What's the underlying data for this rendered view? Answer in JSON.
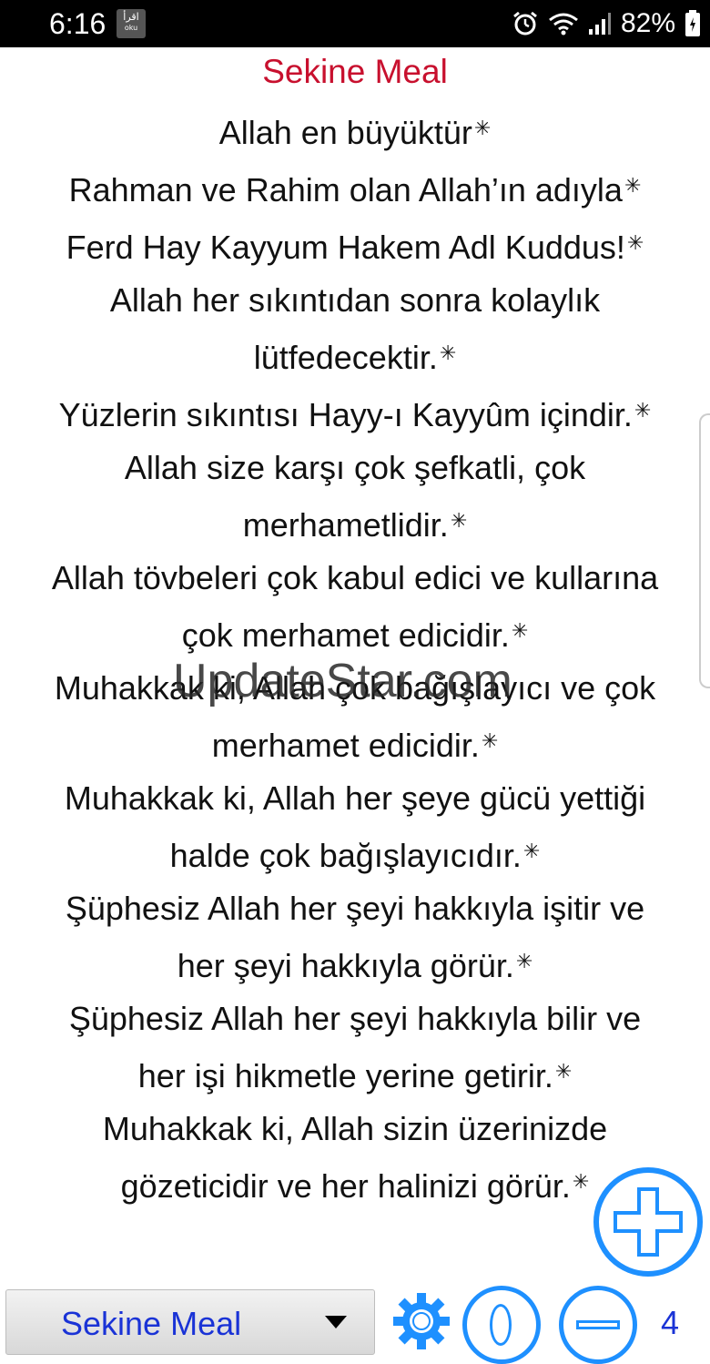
{
  "status_bar": {
    "time": "6:16",
    "app_icon_top": "اقرأ",
    "app_icon_bottom": "oku",
    "battery": "82%",
    "icons": [
      "alarm-icon",
      "wifi-icon",
      "signal-icon",
      "battery-icon"
    ]
  },
  "content": {
    "title": "Sekine Meal",
    "lines": [
      "Allah en büyüktür",
      "Rahman ve Rahim olan Allah’ın adıyla",
      "Ferd Hay Kayyum Hakem Adl Kuddus!",
      "Allah her sıkıntıdan sonra kolaylık",
      "lütfedecektir.",
      "Yüzlerin sıkıntısı Hayy-ı Kayyûm içindir.",
      "Allah size karşı çok şefkatli, çok",
      "merhametlidir.",
      "Allah tövbeleri çok kabul edici ve kullarına",
      "çok merhamet edicidir.",
      "Muhakkak ki, Allah çok bağışlayıcı ve çok",
      "merhamet edicidir.",
      "Muhakkak ki, Allah her şeye gücü yettiği",
      "halde çok bağışlayıcıdır.",
      "Şüphesiz Allah her şeyi hakkıyla işitir ve",
      "her şeyi hakkıyla görür.",
      "Şüphesiz Allah her şeyi hakkıyla bilir ve",
      "her işi hikmetle yerine getirir.",
      "Muhakkak ki, Allah sizin üzerinizde",
      "gözeticidir ve her halinizi görür."
    ],
    "star_after": [
      true,
      true,
      true,
      false,
      true,
      true,
      false,
      true,
      false,
      true,
      false,
      true,
      false,
      true,
      false,
      true,
      false,
      true,
      false,
      true
    ],
    "star_symbol": "✳",
    "watermark": "UpdateStar.com"
  },
  "bottom_bar": {
    "selected_meal": "Sekine Meal",
    "font_level": "4",
    "accent_color": "#1e90ff",
    "label_color": "#1a33d6"
  }
}
